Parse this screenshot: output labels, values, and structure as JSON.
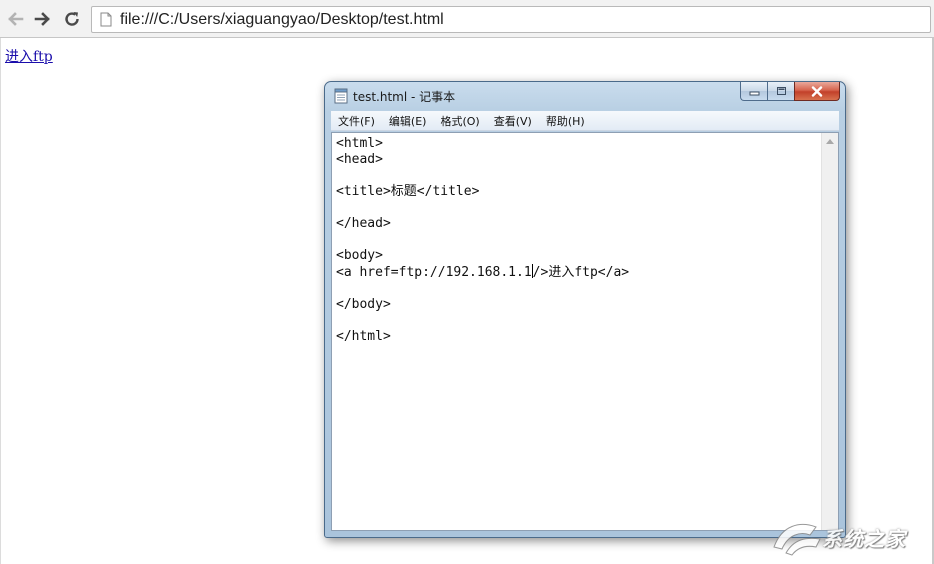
{
  "browser": {
    "url": "file:///C:/Users/xiaguangyao/Desktop/test.html",
    "icons": {
      "back": "arrow-left-icon",
      "forward": "arrow-right-icon",
      "reload": "reload-icon",
      "page": "page-icon"
    }
  },
  "page": {
    "link_text": "进入ftp"
  },
  "notepad": {
    "title": "test.html - 记事本",
    "menu": [
      {
        "label": "文件(F)"
      },
      {
        "label": "编辑(E)"
      },
      {
        "label": "格式(O)"
      },
      {
        "label": "查看(V)"
      },
      {
        "label": "帮助(H)"
      }
    ],
    "content_before_caret": "<html>\n<head>\n\n<title>标题</title>\n\n</head>\n\n<body>\n<a href=ftp://192.168.1.1",
    "content_after_caret": "/>进入ftp</a>\n\n</body>\n\n</html>"
  },
  "watermark": {
    "text": "系统之家"
  },
  "colors": {
    "link": "#1a0dab",
    "close_button": "#c2402a",
    "window_frame": "#b8cfe3"
  }
}
